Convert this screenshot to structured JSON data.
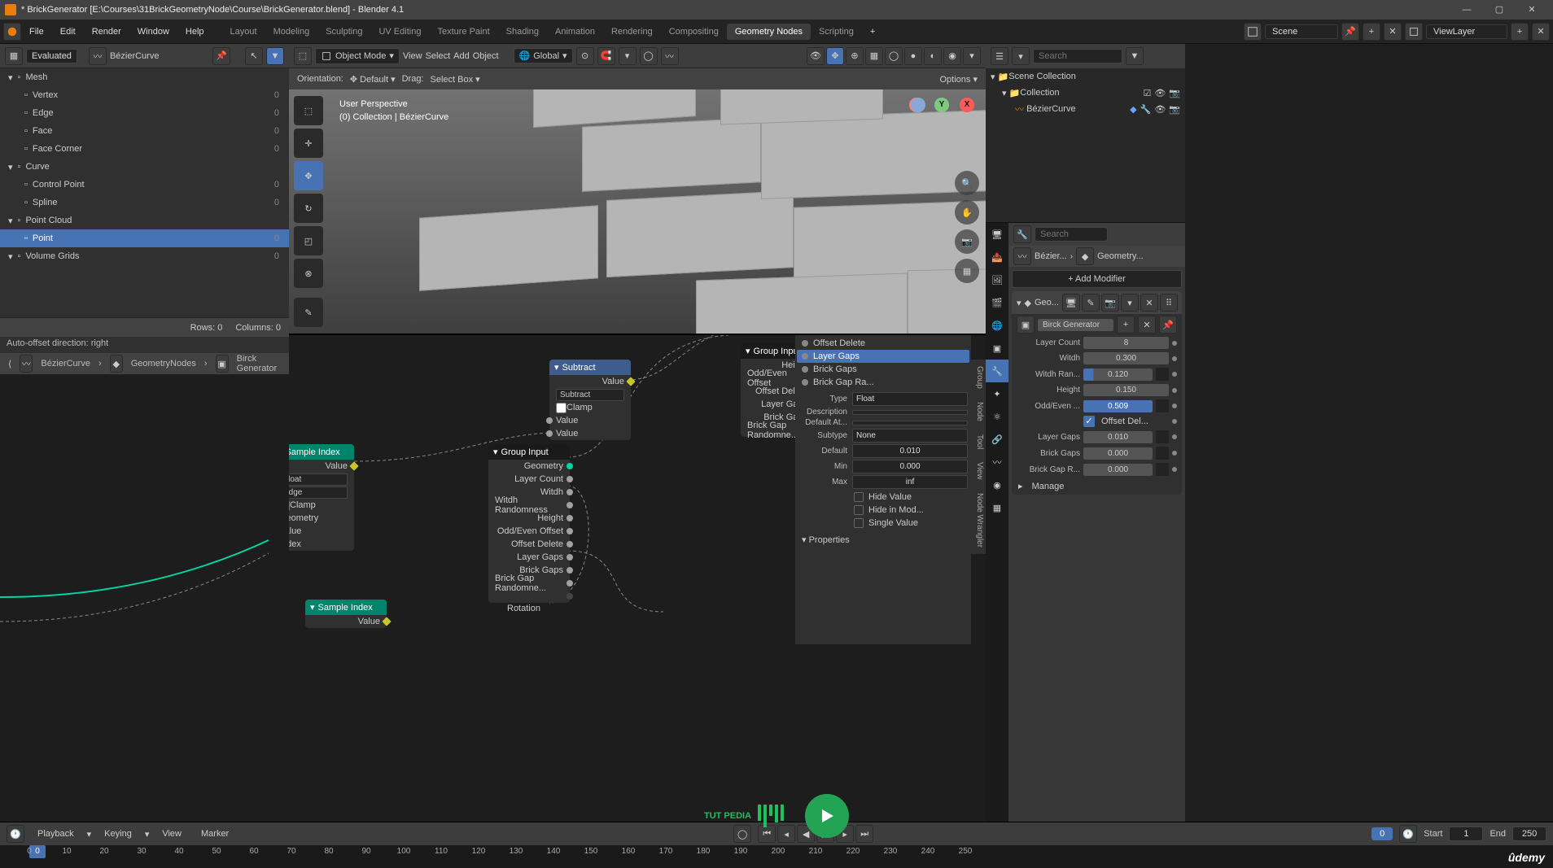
{
  "title": "* BrickGenerator [E:\\Courses\\31BrickGeometryNode\\Course\\BrickGenerator.blend] - Blender 4.1",
  "menubar": [
    "File",
    "Edit",
    "Render",
    "Window",
    "Help"
  ],
  "workspaces": [
    "Layout",
    "Modeling",
    "Sculpting",
    "UV Editing",
    "Texture Paint",
    "Shading",
    "Animation",
    "Rendering",
    "Compositing",
    "Geometry Nodes",
    "Scripting"
  ],
  "active_workspace": "Geometry Nodes",
  "scene": "Scene",
  "viewlayer": "ViewLayer",
  "spreadsheet": {
    "mode": "Evaluated",
    "object": "BézierCurve",
    "tree": [
      {
        "label": "Mesh",
        "count": null,
        "lvl": 0
      },
      {
        "label": "Vertex",
        "count": 0,
        "lvl": 1
      },
      {
        "label": "Edge",
        "count": 0,
        "lvl": 1
      },
      {
        "label": "Face",
        "count": 0,
        "lvl": 1
      },
      {
        "label": "Face Corner",
        "count": 0,
        "lvl": 1
      },
      {
        "label": "Curve",
        "count": null,
        "lvl": 0
      },
      {
        "label": "Control Point",
        "count": 0,
        "lvl": 1
      },
      {
        "label": "Spline",
        "count": 0,
        "lvl": 1
      },
      {
        "label": "Point Cloud",
        "count": null,
        "lvl": 0
      },
      {
        "label": "Point",
        "count": 0,
        "lvl": 1,
        "sel": true
      },
      {
        "label": "Volume Grids",
        "count": 0,
        "lvl": 0
      }
    ],
    "rows_label": "Rows: 0",
    "cols_label": "Columns: 0"
  },
  "status_hint": "Auto-offset direction: right",
  "viewport": {
    "mode": "Object Mode",
    "menus": [
      "View",
      "Select",
      "Add",
      "Object"
    ],
    "orientation_label": "Orientation:",
    "orientation": "Default",
    "drag_label": "Drag:",
    "drag": "Select Box",
    "global": "Global",
    "options": "Options",
    "label_perspective": "User Perspective",
    "label_collection": "(0) Collection | BézierCurve"
  },
  "breadcrumb": [
    "BézierCurve",
    "GeometryNodes",
    "Birck Generator"
  ],
  "nodes": {
    "sample1_name": "Sample Index",
    "sample1_out": "Value",
    "sample1_type": "Float",
    "sample1_domain": "Edge",
    "sample1_clamp": "Clamp",
    "sample1_in": [
      "Geometry",
      "Value",
      "Index"
    ],
    "sample2_name": "Sample Index",
    "sample2_out": "Value",
    "subtract_name": "Subtract",
    "subtract_out": "Value",
    "subtract_op": "Subtract",
    "subtract_clamp": "Clamp",
    "subtract_in1": "Value",
    "subtract_in2": "Value",
    "group_input_name": "Group Input",
    "group_input_socks": [
      "Geometry",
      "Layer Count",
      "Witdh",
      "Witdh Randomness",
      "Height",
      "Odd/Even Offset",
      "Offset Delete",
      "Layer Gaps",
      "Brick Gaps",
      "Brick Gap Randomne..."
    ],
    "group_input2_socks": [
      "Height",
      "Odd/Even Offset",
      "Offset Delete",
      "Layer Gaps",
      "Brick Gaps",
      "Brick Gap Randomne..."
    ],
    "rotation": "Rotation"
  },
  "side_tabs": [
    "Group",
    "Node",
    "Tool",
    "View",
    "Node Wrangler"
  ],
  "sidebar_items": [
    "Offset Delete",
    "Layer Gaps",
    "Brick Gaps",
    "Brick Gap Ra..."
  ],
  "sidebar_sel_idx": 1,
  "sidebar_fields": {
    "type_label": "Type",
    "type": "Float",
    "desc_label": "Description",
    "default_at_label": "Default At...",
    "subtype_label": "Subtype",
    "subtype": "None",
    "default_label": "Default",
    "default": "0.010",
    "min_label": "Min",
    "min": "0.000",
    "max_label": "Max",
    "max": "inf",
    "hide_value": "Hide Value",
    "hide_in_mod": "Hide in Mod...",
    "single_value": "Single Value",
    "properties": "Properties"
  },
  "outliner": {
    "search_ph": "Search",
    "root": "Scene Collection",
    "coll": "Collection",
    "item": "BézierCurve"
  },
  "props": {
    "search_ph": "Search",
    "crumb1": "Bézier...",
    "crumb2": "Geometry...",
    "add_modifier": "Add Modifier",
    "mod_short": "Geo...",
    "nodename": "Birck Generator",
    "fields": [
      {
        "label": "Layer Count",
        "val": "8"
      },
      {
        "label": "Witdh",
        "val": "0.300"
      },
      {
        "label": "Witdh Ran...",
        "val": "0.120",
        "hi": true,
        "ex": true
      },
      {
        "label": "Height",
        "val": "0.150"
      },
      {
        "label": "Odd/Even ...",
        "val": "0.509",
        "sel": true,
        "ex": true
      },
      {
        "label": "",
        "check": true,
        "checklabel": "Offset Del..."
      },
      {
        "label": "Layer Gaps",
        "val": "0.010",
        "ex": true
      },
      {
        "label": "Brick Gaps",
        "val": "0.000",
        "ex": true
      },
      {
        "label": "Brick Gap R...",
        "val": "0.000",
        "ex": true
      }
    ],
    "manage": "Manage"
  },
  "timeline": {
    "playback": "Playback",
    "keying": "Keying",
    "view": "View",
    "marker": "Marker",
    "frame": "0",
    "start_label": "Start",
    "start": "1",
    "end_label": "End",
    "end": "250",
    "ticks": [
      0,
      10,
      20,
      30,
      40,
      50,
      60,
      70,
      80,
      90,
      100,
      110,
      120,
      130,
      140,
      150,
      160,
      170,
      180,
      190,
      200,
      210,
      220,
      230,
      240,
      250
    ]
  },
  "watermark": "TUT PEDIA",
  "udemy": "ûdemy"
}
